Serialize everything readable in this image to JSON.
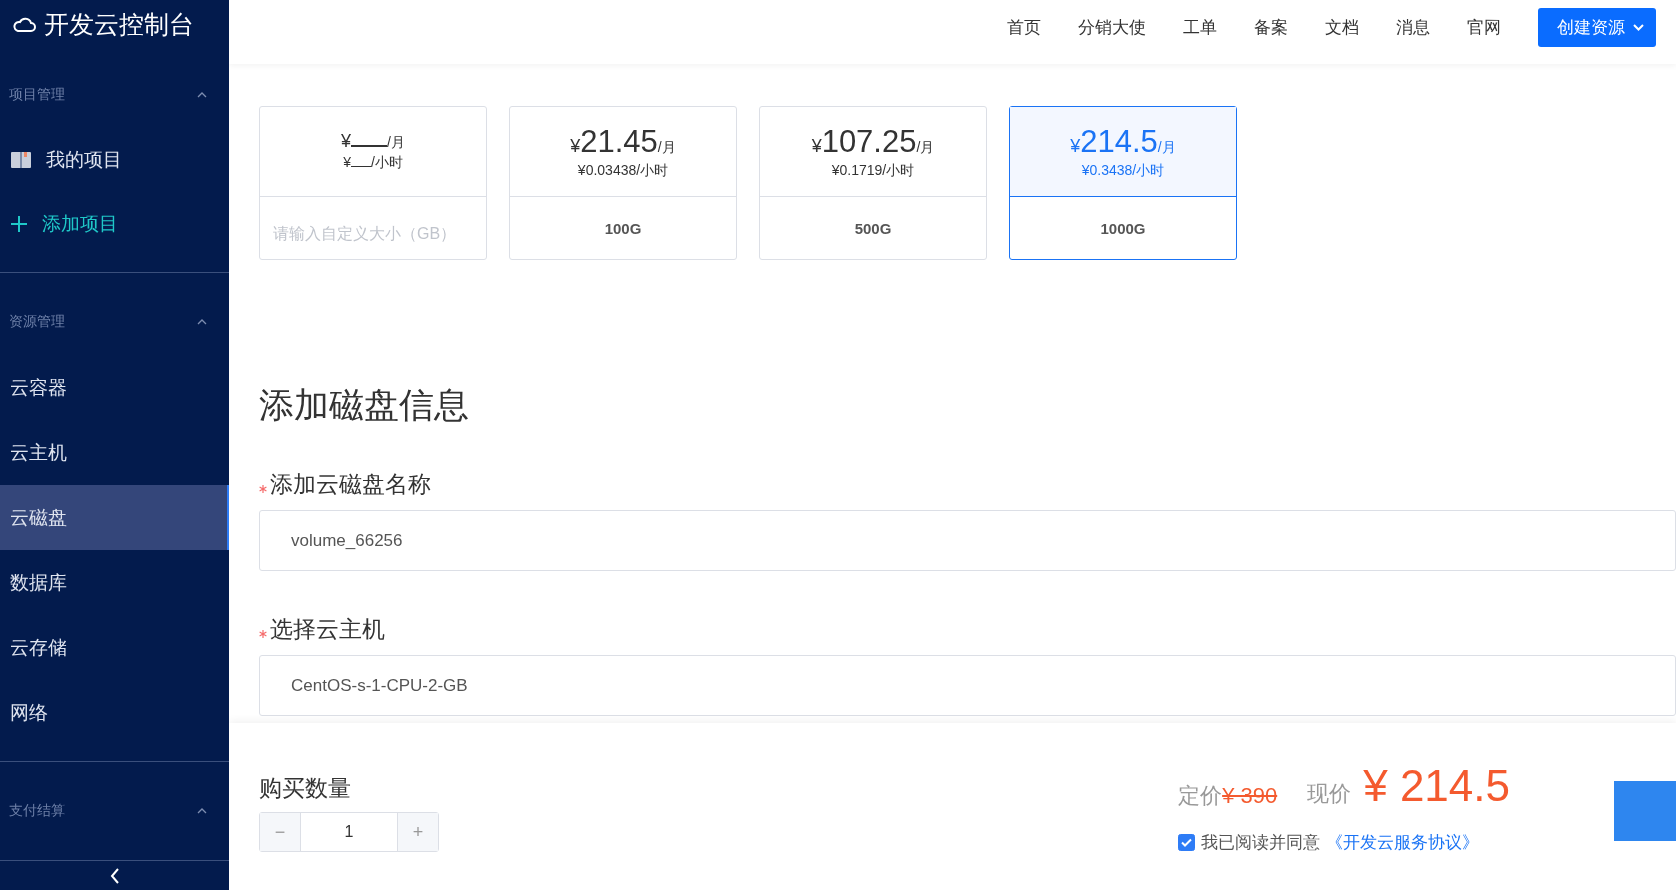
{
  "sidebar": {
    "title": "开发云控制台",
    "groups": [
      {
        "title": "项目管理",
        "expanded": true,
        "items": [
          {
            "label": "我的项目",
            "kind": "book",
            "selected": false
          },
          {
            "label": "添加项目",
            "kind": "add",
            "selected": false
          }
        ]
      },
      {
        "title": "资源管理",
        "expanded": true,
        "items": [
          {
            "label": "云容器",
            "kind": "plain",
            "selected": false
          },
          {
            "label": "云主机",
            "kind": "plain",
            "selected": false
          },
          {
            "label": "云磁盘",
            "kind": "plain",
            "selected": true
          },
          {
            "label": "数据库",
            "kind": "plain",
            "selected": false
          },
          {
            "label": "云存储",
            "kind": "plain",
            "selected": false
          },
          {
            "label": "网络",
            "kind": "plain",
            "selected": false
          }
        ]
      },
      {
        "title": "支付结算",
        "expanded": true
      }
    ]
  },
  "nav": {
    "items": [
      "首页",
      "分销大使",
      "工单",
      "备案",
      "文档",
      "消息",
      "官网"
    ],
    "create_button": "创建资源"
  },
  "disk": {
    "options": [
      {
        "kind": "custom",
        "currency": "¥",
        "month_unit": "/月",
        "hour_currency": "¥",
        "hour_unit": "/小时",
        "placeholder": "请输入自定义大小（GB）",
        "selected": false
      },
      {
        "kind": "preset",
        "currency": "¥",
        "price": "21.45",
        "month_unit": "/月",
        "hourly": "¥0.03438",
        "hour_unit": "/小时",
        "size": "100G",
        "selected": false
      },
      {
        "kind": "preset",
        "currency": "¥",
        "price": "107.25",
        "month_unit": "/月",
        "hourly": "¥0.1719",
        "hour_unit": "/小时",
        "size": "500G",
        "selected": false
      },
      {
        "kind": "preset",
        "currency": "¥",
        "price": "214.5",
        "month_unit": "/月",
        "hourly": "¥0.3438",
        "hour_unit": "/小时",
        "size": "1000G",
        "selected": true
      }
    ]
  },
  "info": {
    "heading": "添加磁盘信息",
    "fields": [
      {
        "label": "添加云磁盘名称",
        "required": true,
        "value": "volume_66256"
      },
      {
        "label": "选择云主机",
        "required": true,
        "value": "CentOS-s-1-CPU-2-GB"
      }
    ]
  },
  "footer": {
    "quantity_label": "购买数量",
    "minus": "−",
    "quantity": "1",
    "plus": "+",
    "list_price_label": "定价",
    "list_price": "¥ 390",
    "price_label": "现价",
    "price": "¥ 214.5",
    "agree": {
      "checked": true,
      "text": "我已阅读并同意",
      "link": "《开发云服务协议》"
    }
  }
}
